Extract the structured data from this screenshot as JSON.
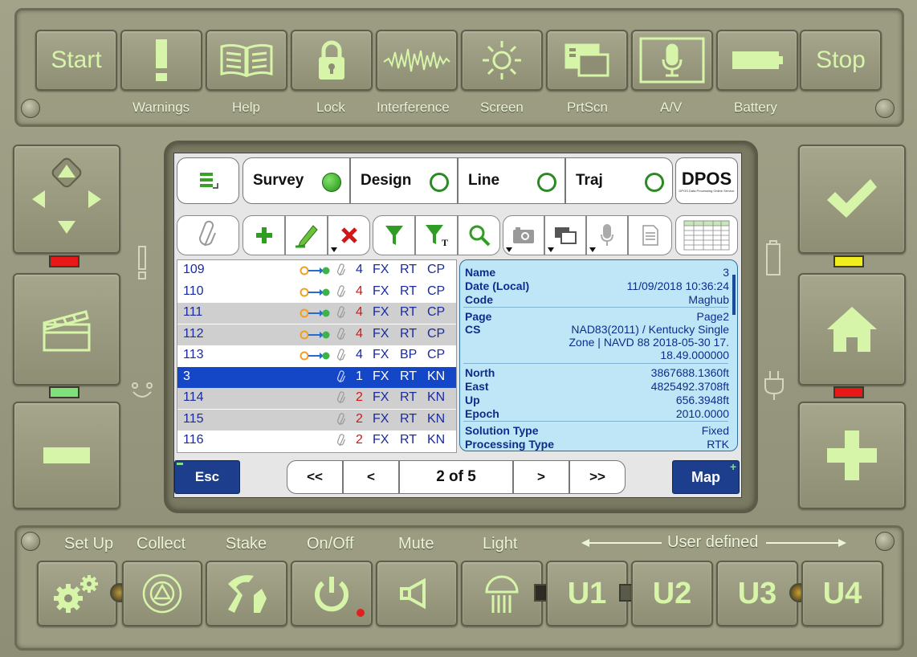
{
  "top_buttons": {
    "start": "Start",
    "stop": "Stop"
  },
  "top_labels": [
    "Warnings",
    "Help",
    "Lock",
    "Interference",
    "Screen",
    "PrtScn",
    "A/V",
    "Battery"
  ],
  "bottom_labels": {
    "setup": "Set Up",
    "collect": "Collect",
    "stake": "Stake",
    "onoff": "On/Off",
    "mute": "Mute",
    "light": "Light",
    "user_defined": "User defined"
  },
  "user_buttons": [
    "U1",
    "U2",
    "U3",
    "U4"
  ],
  "tabs": [
    {
      "label": "Survey",
      "active": true
    },
    {
      "label": "Design",
      "active": false
    },
    {
      "label": "Line",
      "active": false
    },
    {
      "label": "Traj",
      "active": false
    }
  ],
  "dpos": {
    "logo": "DPOS",
    "tagline": "DPOS Data Processing Online Service"
  },
  "rows": [
    {
      "name": "109",
      "arrow": true,
      "count": "4",
      "c1": "FX",
      "c2": "RT",
      "c3": "CP",
      "shade": "white",
      "count_color": "#1a2aa0"
    },
    {
      "name": "110",
      "arrow": true,
      "count": "4",
      "c1": "FX",
      "c2": "RT",
      "c3": "CP",
      "shade": "white",
      "count_color": "#d01818"
    },
    {
      "name": "111",
      "arrow": true,
      "count": "4",
      "c1": "FX",
      "c2": "RT",
      "c3": "CP",
      "shade": "gray",
      "count_color": "#d01818"
    },
    {
      "name": "112",
      "arrow": true,
      "count": "4",
      "c1": "FX",
      "c2": "RT",
      "c3": "CP",
      "shade": "gray",
      "count_color": "#d01818"
    },
    {
      "name": "113",
      "arrow": true,
      "count": "4",
      "c1": "FX",
      "c2": "BP",
      "c3": "CP",
      "shade": "white",
      "count_color": "#1a2aa0"
    },
    {
      "name": "3",
      "arrow": false,
      "count": "1",
      "c1": "FX",
      "c2": "RT",
      "c3": "KN",
      "shade": "selected",
      "count_color": "#ffffff"
    },
    {
      "name": "114",
      "arrow": false,
      "count": "2",
      "c1": "FX",
      "c2": "RT",
      "c3": "KN",
      "shade": "gray",
      "count_color": "#d01818"
    },
    {
      "name": "115",
      "arrow": false,
      "count": "2",
      "c1": "FX",
      "c2": "RT",
      "c3": "KN",
      "shade": "gray",
      "count_color": "#d01818"
    },
    {
      "name": "116",
      "arrow": false,
      "count": "2",
      "c1": "FX",
      "c2": "RT",
      "c3": "KN",
      "shade": "white",
      "count_color": "#d01818"
    }
  ],
  "details": {
    "name_k": "Name",
    "name_v": "3",
    "date_k": "Date (Local)",
    "date_v": "11/09/2018 10:36:24",
    "code_k": "Code",
    "code_v": "Maghub",
    "page_k": "Page",
    "page_v": "Page2",
    "cs_k": "CS",
    "cs_v1": "NAD83(2011) / Kentucky Single",
    "cs_v2": "Zone | NAVD 88 2018-05-30 17.",
    "cs_v3": "18.49.000000",
    "north_k": "North",
    "north_v": "3867688.1360ft",
    "east_k": "East",
    "east_v": "4825492.3708ft",
    "up_k": "Up",
    "up_v": "656.3948ft",
    "epoch_k": "Epoch",
    "epoch_v": "2010.0000",
    "sol_k": "Solution Type",
    "sol_v": "Fixed",
    "proc_k": "Processing Type",
    "proc_v": "RTK"
  },
  "nav": {
    "esc": "Esc",
    "first": "<<",
    "prev": "<",
    "page": "2 of 5",
    "next": ">",
    "last": ">>",
    "map": "Map"
  },
  "colors": {
    "accent": "#d7f5a8",
    "selected_row": "#1446c8",
    "detail_bg": "#bfe6f7",
    "led_red": "#e81818",
    "led_yellow": "#f0ee20",
    "led_green": "#7ee07a"
  }
}
